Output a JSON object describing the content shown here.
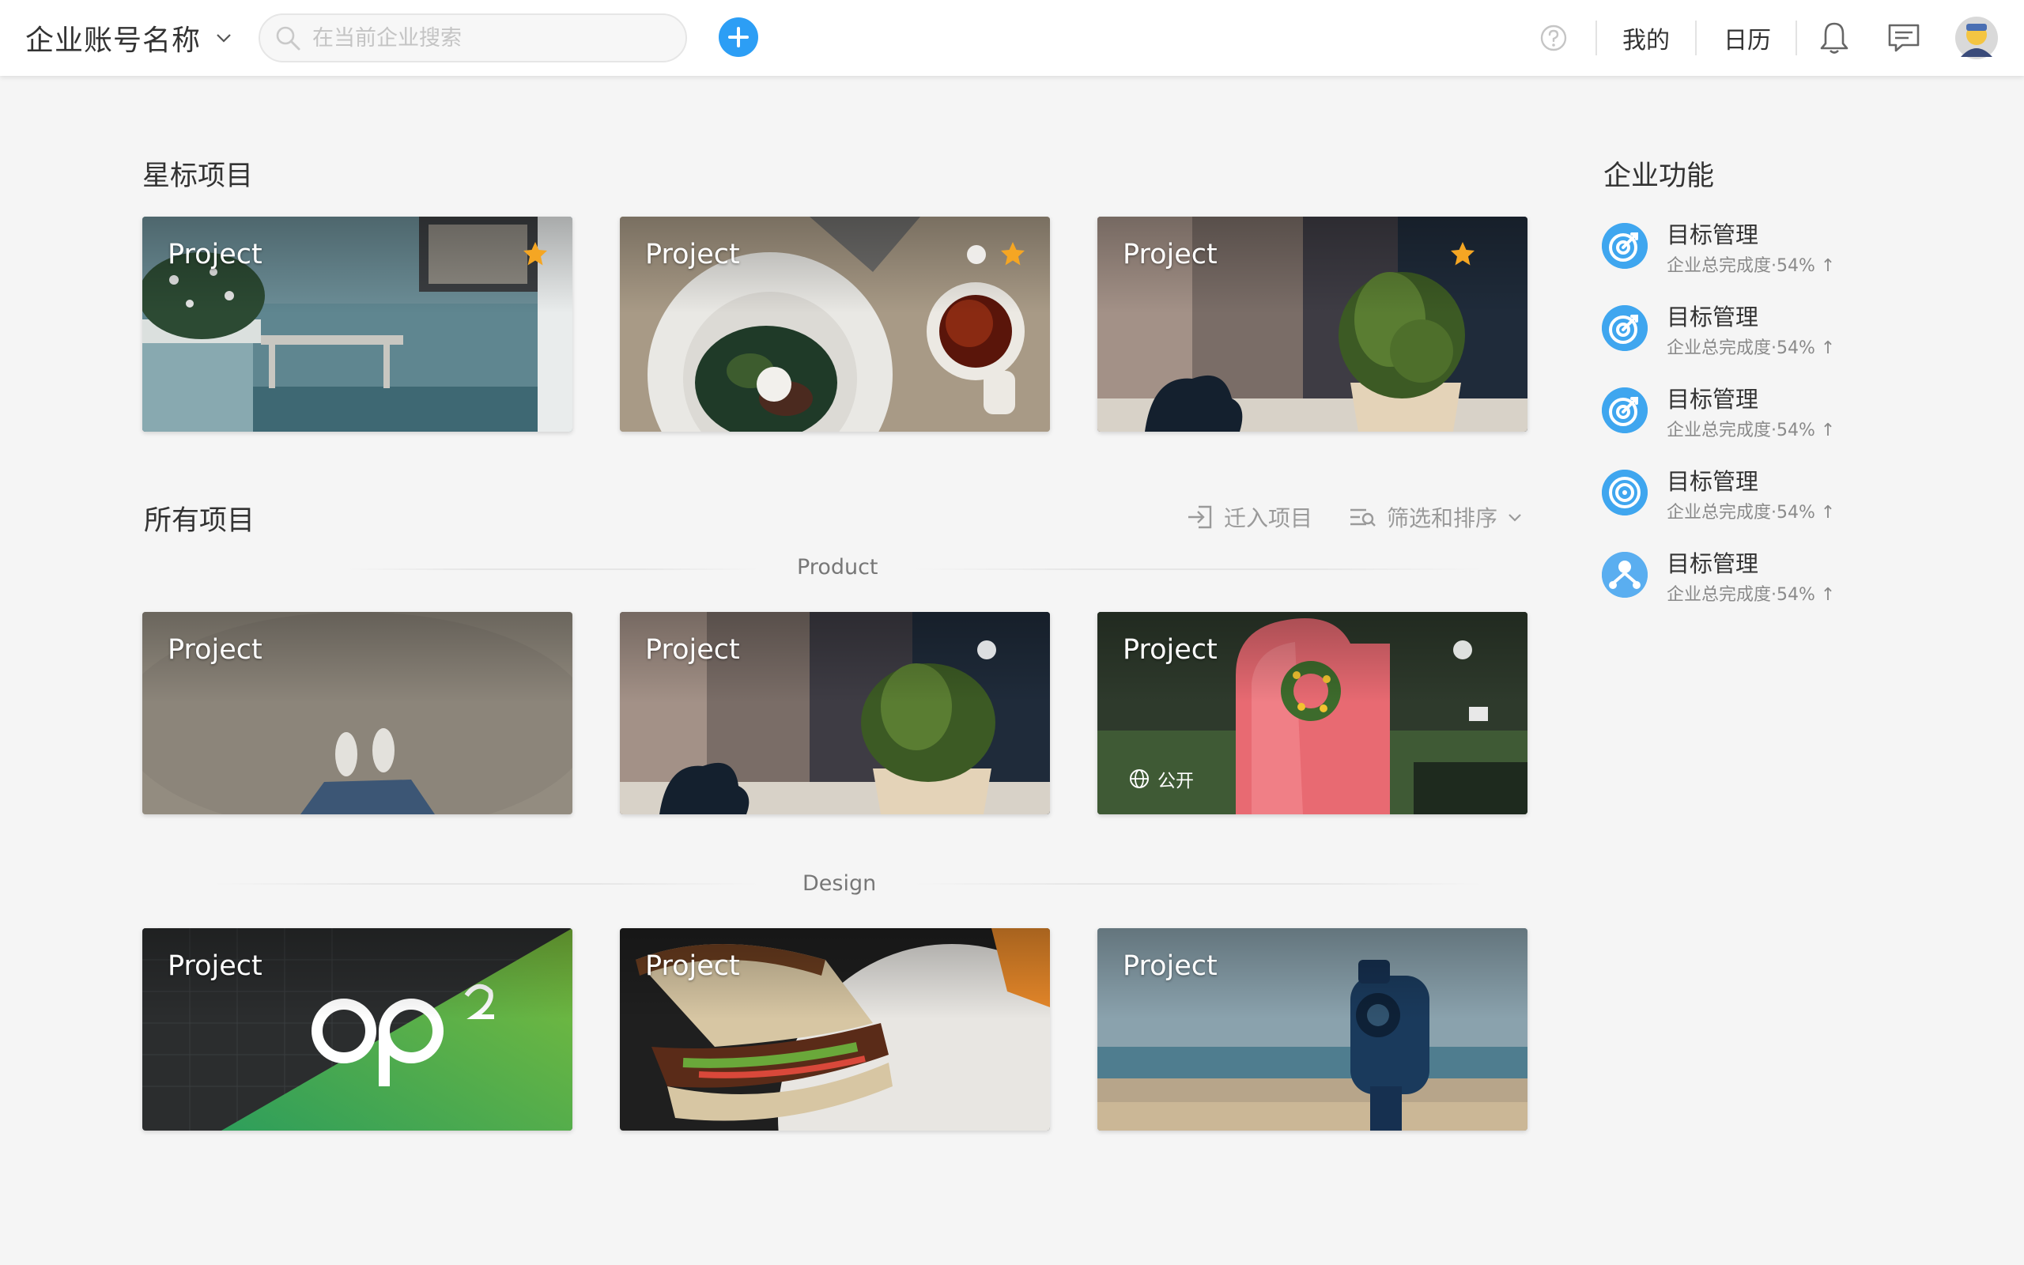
{
  "topbar": {
    "org_name": "企业账号名称",
    "search_placeholder": "在当前企业搜索",
    "mine": "我的",
    "calendar": "日历"
  },
  "starred": {
    "heading": "星标项目",
    "cards": [
      {
        "title": "Project",
        "starred": true
      },
      {
        "title": "Project",
        "starred": true
      },
      {
        "title": "Project",
        "starred": true
      }
    ]
  },
  "all_projects": {
    "heading": "所有项目",
    "move_in": "迁入项目",
    "filter_sort": "筛选和排序",
    "groups": [
      {
        "name": "Product",
        "cards": [
          {
            "title": "Project"
          },
          {
            "title": "Project"
          },
          {
            "title": "Project",
            "badge": "公开"
          }
        ]
      },
      {
        "name": "Design",
        "cards": [
          {
            "title": "Project"
          },
          {
            "title": "Project"
          },
          {
            "title": "Project"
          }
        ]
      }
    ]
  },
  "sidebar": {
    "heading": "企业功能",
    "items": [
      {
        "title": "目标管理",
        "subtitle": "企业总完成度·54%",
        "icon": "target-icon"
      },
      {
        "title": "目标管理",
        "subtitle": "企业总完成度·54%",
        "icon": "target-icon"
      },
      {
        "title": "目标管理",
        "subtitle": "企业总完成度·54%",
        "icon": "target-icon"
      },
      {
        "title": "目标管理",
        "subtitle": "企业总完成度·54%",
        "icon": "target-icon"
      },
      {
        "title": "目标管理",
        "subtitle": "企业总完成度·54%",
        "icon": "team-icon"
      }
    ]
  },
  "colors": {
    "accent": "#2c9ef5",
    "star": "#f5a623",
    "background": "#f5f5f5"
  }
}
